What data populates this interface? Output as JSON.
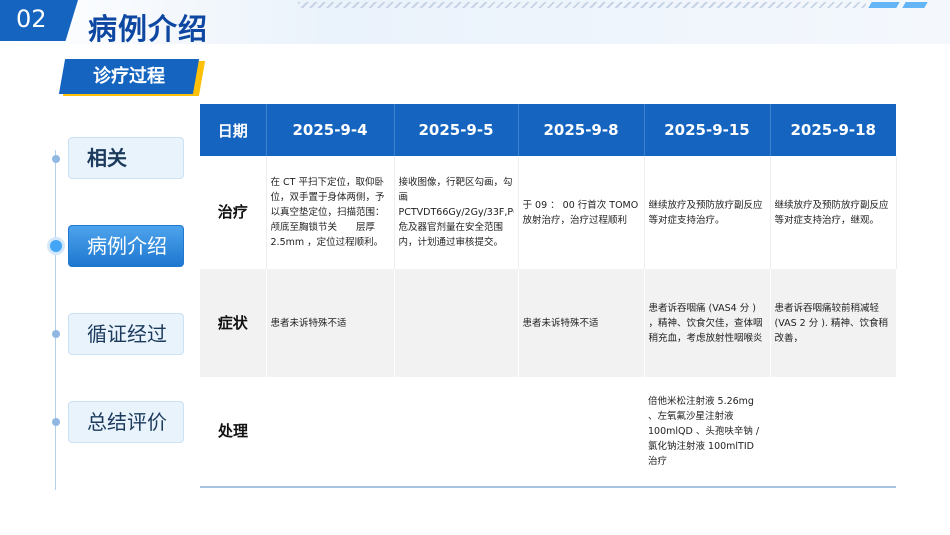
{
  "header": {
    "number": "02",
    "title": "病例介绍"
  },
  "section": {
    "label": "诊疗过程"
  },
  "nav": {
    "items": [
      {
        "label": "相关"
      },
      {
        "label": "病例介绍"
      },
      {
        "label": "循证经过"
      },
      {
        "label": "总结评价"
      }
    ]
  },
  "table": {
    "headers": [
      "日期",
      "2025-9-4",
      "2025-9-5",
      "2025-9-8",
      "2025-9-15",
      "2025-9-18"
    ],
    "rows": [
      {
        "label": "治疗",
        "cells": [
          "在 CT 平扫下定位，取仰卧位，双手置于身体两侧，予以真空垫定位，扫描范围：颅底至胸锁节关　　层厚 2.5mm ，定位过程顺利。",
          "接收图像，行靶区勾画，勾画 PCTVDT66Gy/2Gy/33F,PCTVnDT60Gy/2Gy/30F, 危及器官剂量在安全范围内，计划通过审核提交。",
          "于 09 ： 00 行首次 TOMO 放射治疗，治疗过程顺利",
          "继续放疗及预防放疗副反应等对症支持治疗。",
          "继续放疗及预防放疗副反应等对症支持治疗，继观。"
        ]
      },
      {
        "label": "症状",
        "cells": [
          "患者未诉特殊不适",
          "",
          "患者未诉特殊不适",
          "患者诉吞咽痛 (VAS4 分 ) ，精神、饮食欠佳，查体咽稍充血，考虑放射性咽喉炎",
          "患者诉吞咽痛较前稍减轻 (VAS 2 分 ). 精神、饮食稍改善，"
        ]
      },
      {
        "label": "处理",
        "cells": [
          "",
          "",
          "",
          "倍他米松注射液 5.26mg 、左氧氟沙星注射液 100mlQD 、头孢呋辛钠 / 氯化钠注射液 100mlTID 治疗",
          ""
        ]
      }
    ]
  }
}
